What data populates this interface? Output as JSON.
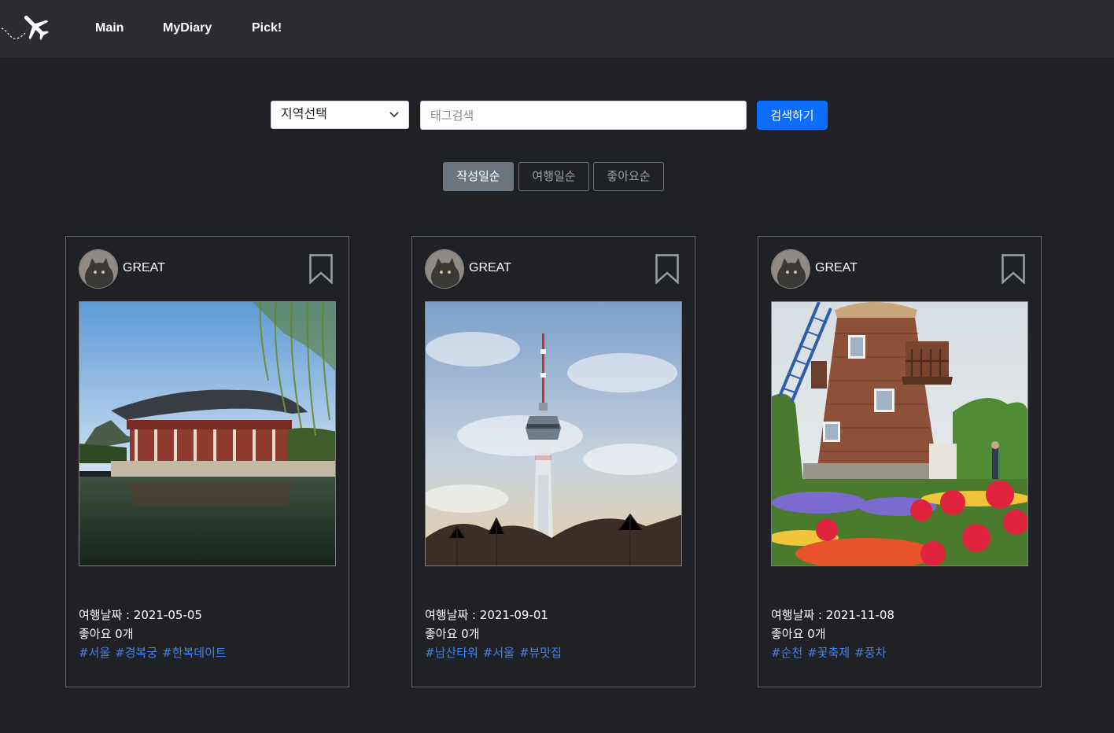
{
  "nav": {
    "items": [
      {
        "label": "Main"
      },
      {
        "label": "MyDiary"
      },
      {
        "label": "Pick!"
      }
    ]
  },
  "search": {
    "region_selected": "지역선택",
    "tag_placeholder": "태그검색",
    "tag_value": "",
    "submit_label": "검색하기"
  },
  "sort": {
    "options": [
      {
        "label": "작성일순",
        "active": true
      },
      {
        "label": "여행일순",
        "active": false
      },
      {
        "label": "좋아요순",
        "active": false
      }
    ]
  },
  "cards": [
    {
      "author": "GREAT",
      "date_label": "여행날짜 : 2021-05-05",
      "likes_label": "좋아요 0개",
      "tags": [
        "#서울",
        "#경복궁",
        "#한복데이트"
      ],
      "photo_icon": "palace-photo"
    },
    {
      "author": "GREAT",
      "date_label": "여행날짜 : 2021-09-01",
      "likes_label": "좋아요 0개",
      "tags": [
        "#남산타워",
        "#서울",
        "#뷰맛집"
      ],
      "photo_icon": "tower-photo"
    },
    {
      "author": "GREAT",
      "date_label": "여행날짜 : 2021-11-08",
      "likes_label": "좋아요 0개",
      "tags": [
        "#순천",
        "#꽃축제",
        "#풍차"
      ],
      "photo_icon": "windmill-photo"
    }
  ],
  "colors": {
    "background": "#202124",
    "navbar": "#2b2c2f",
    "primary": "#0d6efd",
    "tag": "#3b82f6",
    "sort_active": "#6c757d"
  }
}
